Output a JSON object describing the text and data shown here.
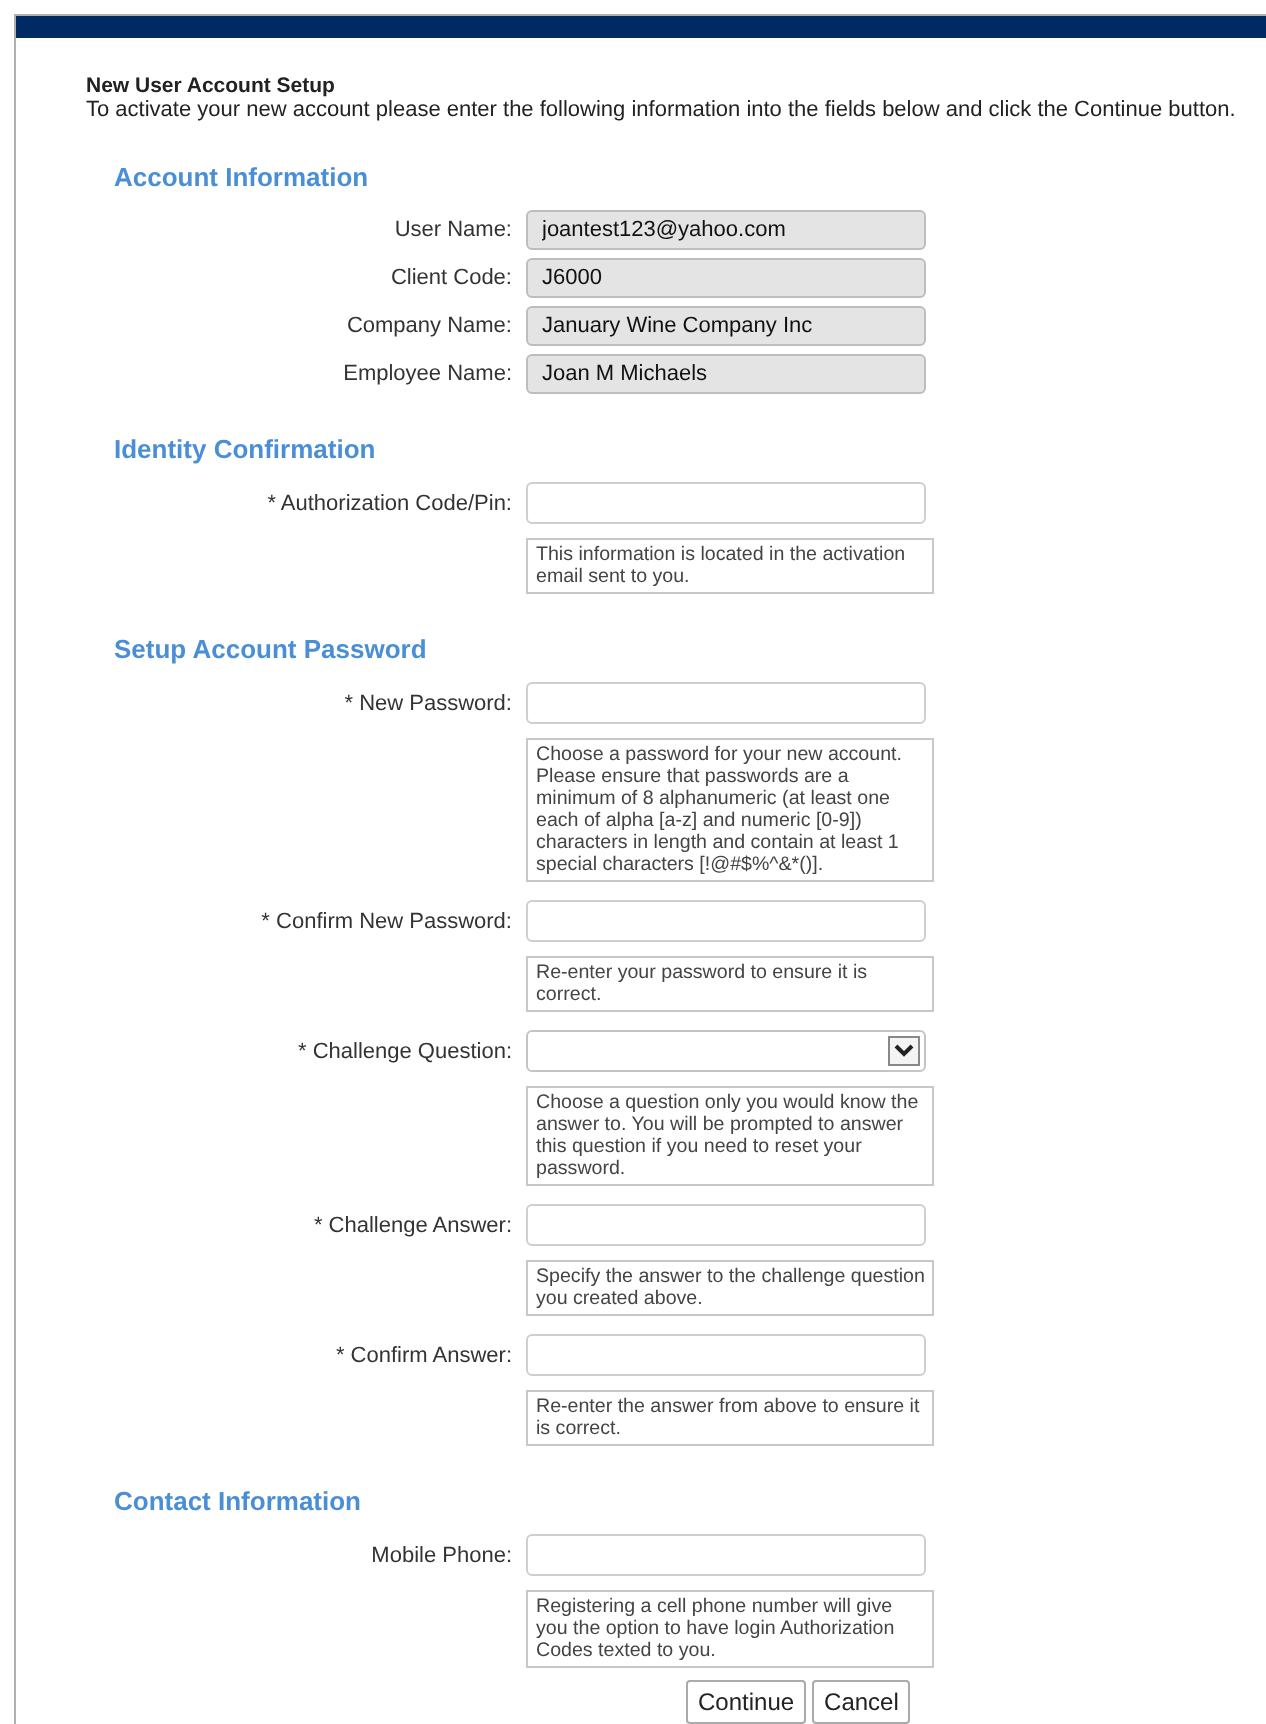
{
  "header": {
    "title": "New User Account Setup",
    "description": "To activate your new account please enter the following information into the fields below and click the Continue button."
  },
  "sections": [
    {
      "heading": "Account Information",
      "fields": [
        {
          "label": "User Name:",
          "kind": "text",
          "readonly": true,
          "value": "joantest123@yahoo.com"
        },
        {
          "label": "Client Code:",
          "kind": "text",
          "readonly": true,
          "value": "J6000"
        },
        {
          "label": "Company Name:",
          "kind": "text",
          "readonly": true,
          "value": "January Wine Company Inc"
        },
        {
          "label": "Employee Name:",
          "kind": "text",
          "readonly": true,
          "value": "Joan M Michaels"
        }
      ]
    },
    {
      "heading": "Identity Confirmation",
      "fields": [
        {
          "label": "* Authorization Code/Pin:",
          "kind": "text",
          "readonly": false,
          "help": "This information is located in the activation email sent to you."
        }
      ]
    },
    {
      "heading": "Setup Account Password",
      "fields": [
        {
          "label": "* New Password:",
          "kind": "text",
          "readonly": false,
          "help": "Choose a password for your new account. Please ensure that passwords are a minimum of 8 alphanumeric (at least one each of alpha [a-z] and numeric [0-9]) characters in length and contain at least 1 special characters [!@#$%^&*()]."
        },
        {
          "label": "* Confirm New Password:",
          "kind": "text",
          "readonly": false,
          "help": "Re-enter your password to ensure it is correct."
        },
        {
          "label": "* Challenge Question:",
          "kind": "select",
          "readonly": false,
          "help": "Choose a question only you would know the answer to. You will be prompted to answer this question if you need to reset your password."
        },
        {
          "label": "* Challenge Answer:",
          "kind": "text",
          "readonly": false,
          "help": "Specify the answer to the challenge question you created above."
        },
        {
          "label": "* Confirm Answer:",
          "kind": "text",
          "readonly": false,
          "help": "Re-enter the answer from above to ensure it is correct."
        }
      ]
    },
    {
      "heading": "Contact Information",
      "fields": [
        {
          "label": "Mobile Phone:",
          "kind": "text",
          "readonly": false,
          "help": "Registering a cell phone number will give you the option to have login Authorization Codes texted to you."
        }
      ]
    }
  ],
  "buttons": [
    "Continue",
    "Cancel"
  ]
}
